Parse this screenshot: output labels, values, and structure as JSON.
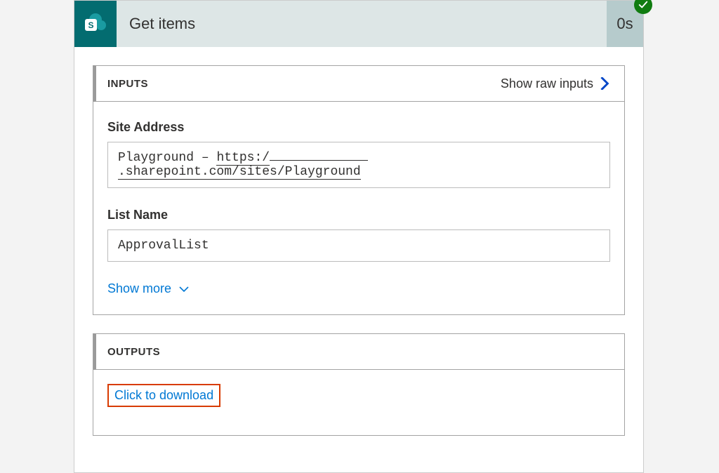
{
  "header": {
    "title": "Get items",
    "duration": "0s",
    "icon": "sharepoint-icon",
    "icon_letter": "S",
    "status": "success"
  },
  "inputs": {
    "section_title": "INPUTS",
    "raw_link": "Show raw inputs",
    "fields": {
      "site_address": {
        "label": "Site Address",
        "prefix": "Playground – ",
        "url_protocol": "https:/",
        "url_suffix": ".sharepoint.com/sites/Playground"
      },
      "list_name": {
        "label": "List Name",
        "value": "ApprovalList"
      }
    },
    "show_more": "Show more"
  },
  "outputs": {
    "section_title": "OUTPUTS",
    "download_link": "Click to download"
  },
  "colors": {
    "accent": "#036c70",
    "link": "#0078d4",
    "highlight": "#d83b01",
    "success": "#107c10"
  }
}
